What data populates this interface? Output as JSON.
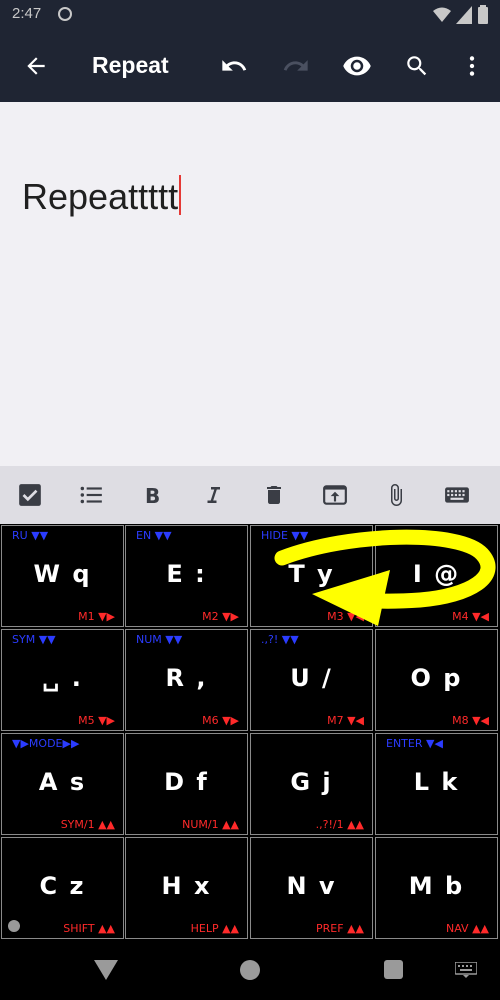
{
  "status_bar": {
    "time": "2:47"
  },
  "app_bar": {
    "title": "Repeat",
    "icons": [
      "back-arrow-icon",
      "undo-icon",
      "redo-icon",
      "preview-eye-icon",
      "search-icon",
      "more-vert-icon"
    ]
  },
  "editor": {
    "text": "Repeattttt"
  },
  "format_toolbar": {
    "icons": [
      "checkbox-icon",
      "bullet-list-icon",
      "bold-icon",
      "italic-icon",
      "delete-icon",
      "share-icon",
      "attach-icon",
      "keyboard-icon"
    ]
  },
  "keyboard": {
    "rows": [
      [
        {
          "main": "W q",
          "tl": "RU ▼▼",
          "br": "M1 ▼▶"
        },
        {
          "main": "E :",
          "tl": "EN ▼▼",
          "br": "M2 ▼▶"
        },
        {
          "main": "T y",
          "tl": "HIDE ▼▼",
          "br": "M3 ▼◀"
        },
        {
          "main": "I @",
          "tl": "",
          "br": "M4 ▼◀"
        }
      ],
      [
        {
          "main": "␣ .",
          "tl": "SYM ▼▼",
          "br": "M5 ▼▶"
        },
        {
          "main": "R ,",
          "tl": "NUM ▼▼",
          "br": "M6 ▼▶"
        },
        {
          "main": "U /",
          "tl": ".,?! ▼▼",
          "br": "M7 ▼◀"
        },
        {
          "main": "O p",
          "tl": "",
          "br": "M8 ▼◀"
        }
      ],
      [
        {
          "main": "A s",
          "tl": "▼▶MODE▶▶",
          "br": "SYM/1 ▲▲"
        },
        {
          "main": "D f",
          "tl": "",
          "br": "NUM/1 ▲▲"
        },
        {
          "main": "G j",
          "tl": "",
          "br": ".,?!/1 ▲▲"
        },
        {
          "main": "L k",
          "tl": "ENTER ▼◀",
          "br": ""
        }
      ],
      [
        {
          "main": "C z",
          "tl": "",
          "br": "SHIFT ▲▲"
        },
        {
          "main": "H x",
          "tl": "",
          "br": "HELP ▲▲"
        },
        {
          "main": "N v",
          "tl": "",
          "br": "PREF ▲▲"
        },
        {
          "main": "M b",
          "tl": "",
          "br": "NAV ▲▲"
        }
      ]
    ],
    "gesture_annotation": "swipe-arrow (yellow)"
  },
  "nav_bar": {
    "icons": [
      "back-triangle-icon",
      "home-circle-icon",
      "recents-square-icon",
      "keyboard-switch-icon"
    ]
  },
  "colors": {
    "app_bar": "#1f2533",
    "editor_bg": "#f1f0f4",
    "toolbar_bg": "#dedde3",
    "key_bg": "#000000",
    "accent_blue": "#2b3cff",
    "accent_red": "#ff2a2a",
    "gesture_yellow": "#ffff00",
    "caret": "#e53935"
  }
}
